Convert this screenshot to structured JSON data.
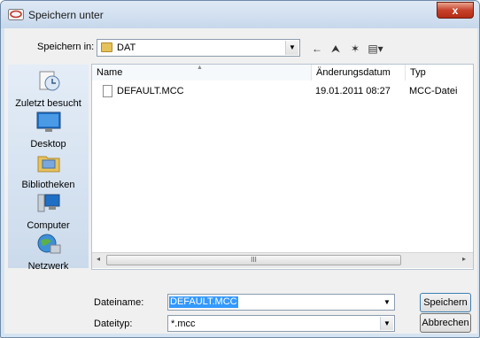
{
  "window": {
    "title": "Speichern unter",
    "close_glyph": "x"
  },
  "location": {
    "label": "Speichern in:",
    "folder": "DAT"
  },
  "toolbar": {
    "back_glyph": "←",
    "up_glyph": "⮝",
    "newfolder_glyph": "✶",
    "views_glyph": "▤▾"
  },
  "places": [
    {
      "label": "Zuletzt besucht",
      "icon": "recent-places-icon"
    },
    {
      "label": "Desktop",
      "icon": "desktop-icon"
    },
    {
      "label": "Bibliotheken",
      "icon": "libraries-icon"
    },
    {
      "label": "Computer",
      "icon": "computer-icon"
    },
    {
      "label": "Netzwerk",
      "icon": "network-icon"
    }
  ],
  "columns": {
    "name": "Name",
    "date": "Änderungsdatum",
    "type": "Typ"
  },
  "files": [
    {
      "name": "DEFAULT.MCC",
      "date": "19.01.2011 08:27",
      "type": "MCC-Datei"
    }
  ],
  "scrollbar": {
    "left_glyph": "◂",
    "right_glyph": "▸",
    "grip": "III"
  },
  "form": {
    "filename_label": "Dateiname:",
    "filename_value": "DEFAULT.MCC",
    "filetype_label": "Dateityp:",
    "filetype_value": "*.mcc"
  },
  "buttons": {
    "save": "Speichern",
    "cancel": "Abbrechen"
  }
}
